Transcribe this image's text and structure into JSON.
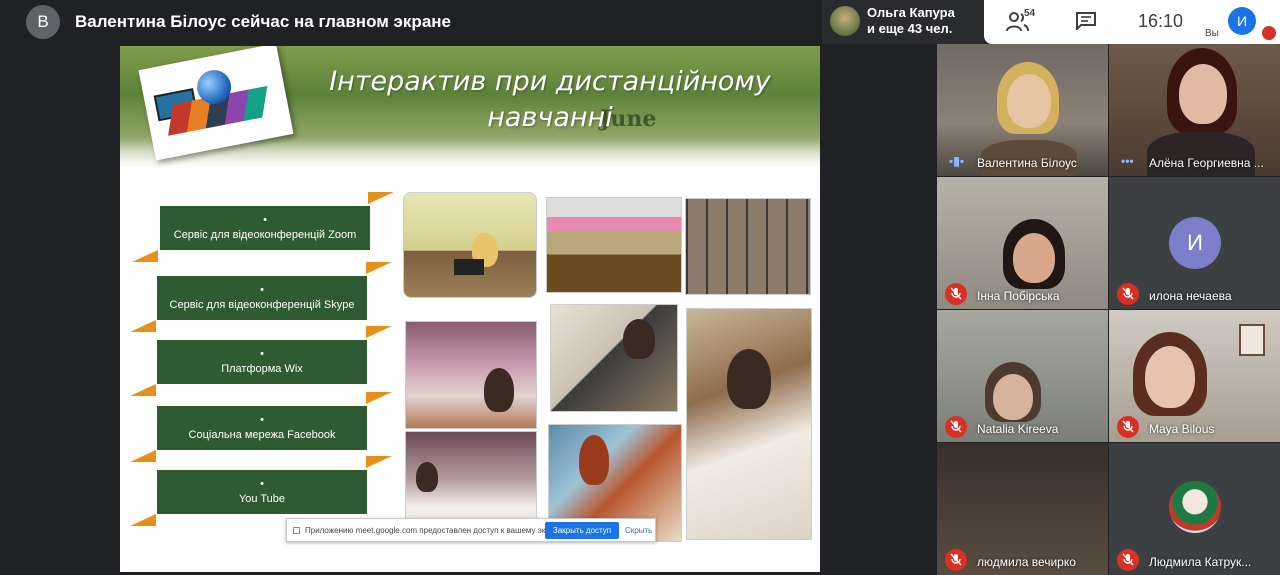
{
  "header": {
    "presenter_initial": "В",
    "presenting_title": "Валентина Білоус сейчас на главном экране",
    "others_line1": "Ольга Капура",
    "others_line2": "и еще 43 чел.",
    "participants_count": "54",
    "clock": "16:10",
    "you_label": "Вы",
    "self_initial": "И",
    "icons": [
      "people-icon",
      "chat-icon",
      "mic-off-icon"
    ]
  },
  "slide": {
    "title": "Інтерактив при дистанційному навчанні",
    "watermark": "June",
    "items": [
      "Сервіс для відеоконференцій Zoom",
      "Сервіс для відеоконференцій Skype",
      "Платформа Wix",
      "Соціальна мережа Facebook",
      "You Tube"
    ],
    "bullet": "•",
    "share_notice": "Приложению meet.google.com предоставлен доступ к вашему экрану.",
    "share_stop": "Закрыть доступ",
    "share_hide": "Скрыть"
  },
  "participants": [
    {
      "name": "Валентина Білоус",
      "muted": false,
      "speaking": true
    },
    {
      "name": "Алёна Георгиевна ...",
      "muted": false,
      "speaking": false
    },
    {
      "name": "Інна Побірська",
      "muted": true
    },
    {
      "name": "илона нечаева",
      "muted": true,
      "initial": "И"
    },
    {
      "name": "Natalia Kireeva",
      "muted": true
    },
    {
      "name": "Maya Bilous",
      "muted": true
    },
    {
      "name": "людмила вечирко",
      "muted": true
    },
    {
      "name": "Людмила Катрук...",
      "muted": true
    }
  ],
  "colors": {
    "background": "#202124",
    "slide_green": "#2f5b32",
    "accent_orange": "#e6901c",
    "self_avatar": "#1a73e8",
    "mute_red": "#d93025",
    "avatar_purple": "#7b7fc9"
  }
}
